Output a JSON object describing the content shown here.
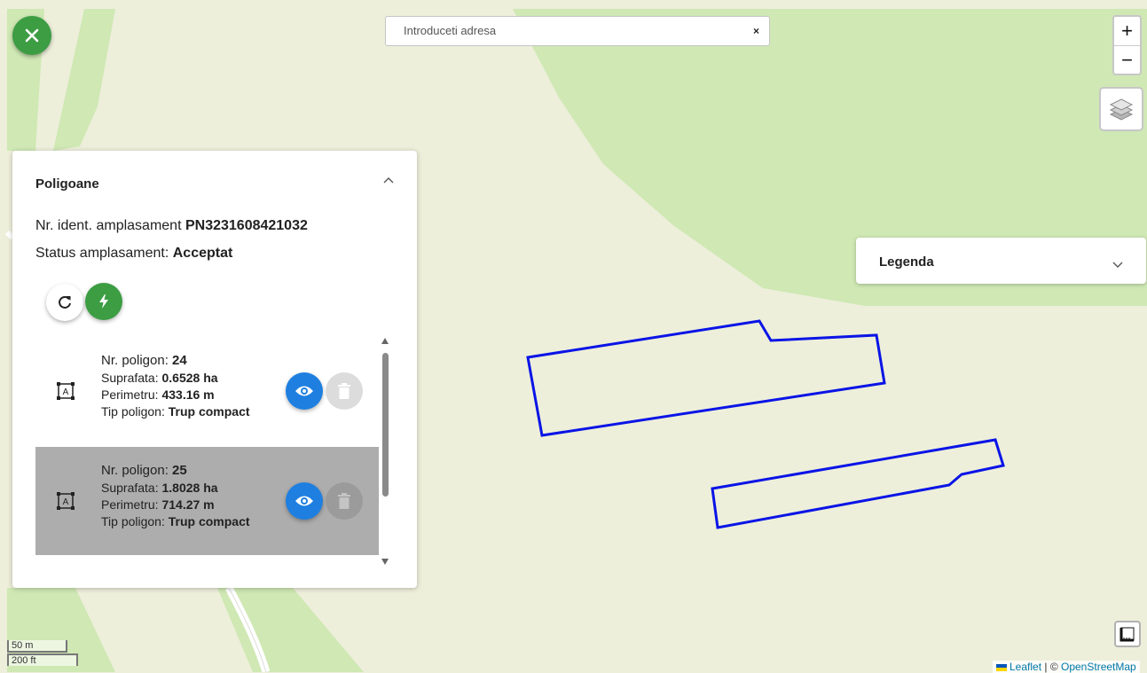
{
  "search": {
    "placeholder": "Introduceti adresa",
    "clear_label": "×"
  },
  "zoom": {
    "in_label": "+",
    "out_label": "−"
  },
  "panel": {
    "title": "Poligoane",
    "ident_label": "Nr. ident. amplasament ",
    "ident_value": "PN3231608421032",
    "status_label": "Status amplasament: ",
    "status_value": "Acceptat",
    "items": [
      {
        "nr_label": "Nr. poligon: ",
        "nr": "24",
        "suprafata_label": "Suprafata: ",
        "suprafata": "0.6528 ha",
        "perimetru_label": "Perimetru: ",
        "perimetru": "433.16 m",
        "tip_label": "Tip poligon: ",
        "tip": "Trup compact"
      },
      {
        "nr_label": "Nr. poligon: ",
        "nr": "25",
        "suprafata_label": "Suprafata: ",
        "suprafata": "1.8028 ha",
        "perimetru_label": "Perimetru: ",
        "perimetru": "714.27 m",
        "tip_label": "Tip poligon: ",
        "tip": "Trup compact"
      }
    ]
  },
  "legend": {
    "title": "Legenda"
  },
  "scale": {
    "metric": "50 m",
    "imperial": "200 ft"
  },
  "attribution": {
    "leaflet": "Leaflet",
    "separator": " | © ",
    "osm": "OpenStreetMap"
  },
  "colors": {
    "accent_green": "#3c9d43",
    "eye_blue": "#1e7fe0",
    "polygon_stroke": "#0a14e6"
  }
}
